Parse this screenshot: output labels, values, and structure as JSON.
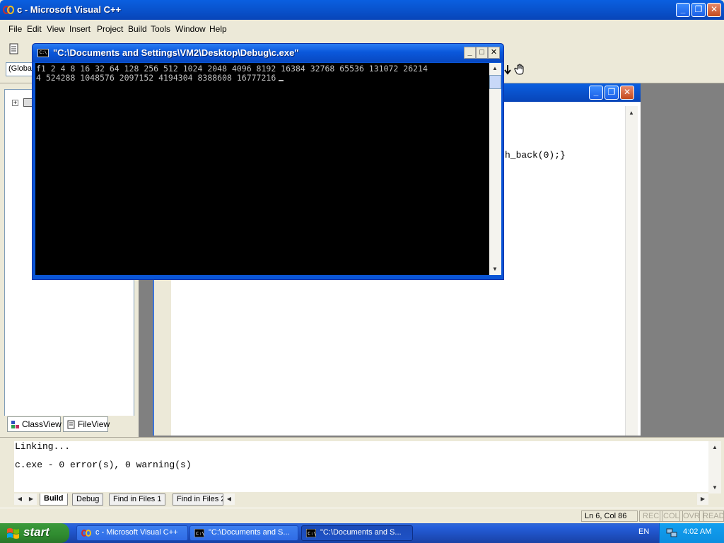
{
  "main_window": {
    "title": "c - Microsoft Visual C++"
  },
  "menu": [
    "File",
    "Edit",
    "View",
    "Insert",
    "Project",
    "Build",
    "Tools",
    "Window",
    "Help"
  ],
  "toolbar": {
    "class_combo": "(Globa"
  },
  "workspace": {
    "tabs": [
      "ClassView",
      "FileView"
    ]
  },
  "editor": {
    "visible_code": "h_back(0);}"
  },
  "console": {
    "title": "\"C:\\Documents and Settings\\VM2\\Desktop\\Debug\\c.exe\"",
    "line1": "f1 2 4 8 16 32 64 128 256 512 1024 2048 4096 8192 16384 32768 65536 131072 26214",
    "line2": "4 524288 1048576 2097152 4194304 8388608 16777216"
  },
  "output": {
    "lines": [
      "Linking...",
      "c.exe - 0 error(s), 0 warning(s)"
    ],
    "tabs": [
      "Build",
      "Debug",
      "Find in Files 1",
      "Find in Files 2"
    ]
  },
  "status": {
    "position": "Ln 6, Col 86",
    "indicators": [
      "REC",
      "COL",
      "OVR",
      "READ"
    ]
  },
  "taskbar": {
    "start_label": "start",
    "buttons": [
      "c - Microsoft Visual C++",
      "\"C:\\Documents and S...",
      "\"C:\\Documents and S..."
    ],
    "language": "EN",
    "clock": "4:02 AM"
  }
}
